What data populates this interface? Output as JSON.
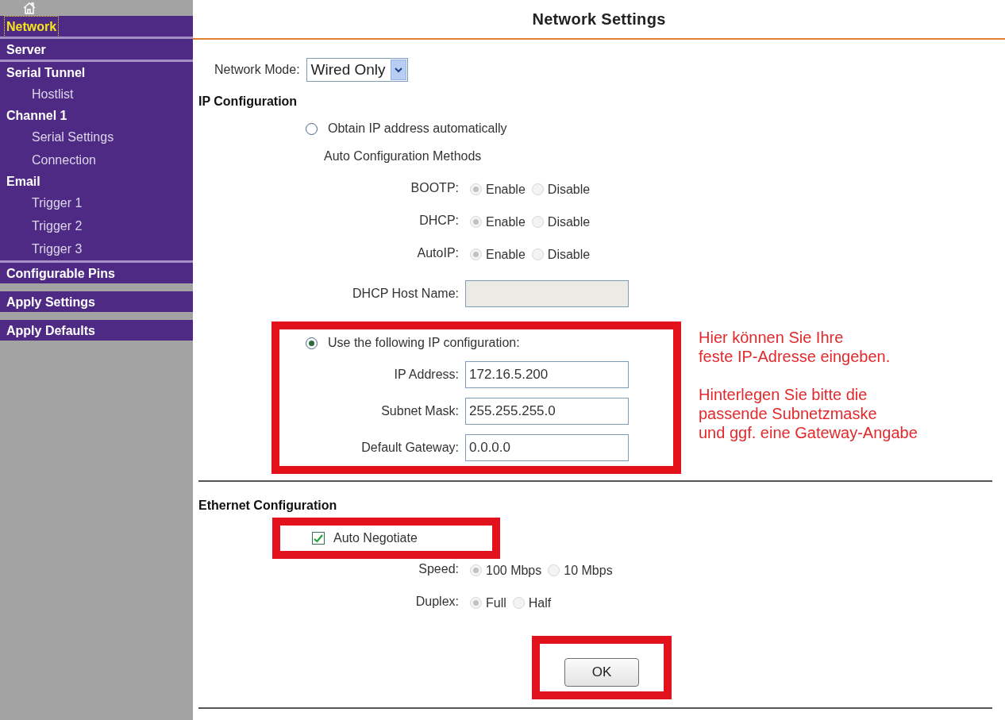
{
  "sidebar": {
    "groups": [
      {
        "divider_above": false,
        "gap_above": false,
        "items": [
          {
            "label": "Network",
            "selected": true
          }
        ]
      },
      {
        "divider_above": true,
        "gap_above": false,
        "items": [
          {
            "label": "Server",
            "selected": false
          }
        ]
      },
      {
        "divider_above": true,
        "gap_above": false,
        "items": [
          {
            "label": "Serial Tunnel",
            "selected": false,
            "children": [
              {
                "label": "Hostlist",
                "selected": false
              }
            ]
          },
          {
            "label": "Channel 1",
            "selected": false,
            "children": [
              {
                "label": "Serial Settings",
                "selected": false
              },
              {
                "label": "Connection",
                "selected": false
              }
            ]
          },
          {
            "label": "Email",
            "selected": false,
            "children": [
              {
                "label": "Trigger 1",
                "selected": false
              },
              {
                "label": "Trigger 2",
                "selected": false
              },
              {
                "label": "Trigger 3",
                "selected": false
              }
            ]
          }
        ]
      },
      {
        "divider_above": true,
        "gap_above": false,
        "items": [
          {
            "label": "Configurable Pins",
            "selected": false
          }
        ]
      },
      {
        "divider_above": false,
        "gap_above": true,
        "items": [
          {
            "label": "Apply Settings",
            "selected": false
          }
        ]
      },
      {
        "divider_above": false,
        "gap_above": true,
        "items": [
          {
            "label": "Apply Defaults",
            "selected": false
          }
        ]
      }
    ]
  },
  "title": "Network Settings",
  "network_mode": {
    "label": "Network Mode:",
    "value": "Wired Only"
  },
  "ip_configuration": {
    "heading": "IP Configuration",
    "auto": {
      "label": "Obtain IP address automatically",
      "selected": false,
      "methods_heading": "Auto Configuration Methods",
      "methods": [
        {
          "label": "BOOTP:",
          "disabled": true,
          "options": [
            {
              "label": "Enable",
              "selected": true
            },
            {
              "label": "Disable",
              "selected": false
            }
          ]
        },
        {
          "label": "DHCP:",
          "disabled": true,
          "options": [
            {
              "label": "Enable",
              "selected": true
            },
            {
              "label": "Disable",
              "selected": false
            }
          ]
        },
        {
          "label": "AutoIP:",
          "disabled": true,
          "options": [
            {
              "label": "Enable",
              "selected": true
            },
            {
              "label": "Disable",
              "selected": false
            }
          ]
        }
      ],
      "host_name": {
        "label": "DHCP Host Name:",
        "disabled": true
      }
    },
    "static": {
      "label": "Use the following IP configuration:",
      "selected": true,
      "highlighted": true,
      "fields": [
        {
          "label": "IP Address:",
          "value": "172.16.5.200"
        },
        {
          "label": "Subnet Mask:",
          "value": "255.255.255.0"
        },
        {
          "label": "Default Gateway:",
          "value": "0.0.0.0"
        }
      ]
    }
  },
  "note": {
    "paragraphs": [
      [
        "Hier können Sie Ihre",
        "feste IP-Adresse eingeben."
      ],
      [
        "Hinterlegen Sie bitte die",
        "passende Subnetzmaske",
        "und ggf. eine Gateway-Angabe"
      ]
    ]
  },
  "ethernet": {
    "heading": "Ethernet Configuration",
    "auto_negotiate": {
      "label": "Auto Negotiate",
      "checked": true,
      "highlighted": true
    },
    "settings": [
      {
        "label": "Speed:",
        "disabled": true,
        "options": [
          {
            "label": "100 Mbps",
            "selected": true
          },
          {
            "label": "10 Mbps",
            "selected": false
          }
        ]
      },
      {
        "label": "Duplex:",
        "disabled": true,
        "options": [
          {
            "label": "Full",
            "selected": true
          },
          {
            "label": "Half",
            "selected": false
          }
        ]
      }
    ]
  },
  "ok_button": {
    "label": "OK",
    "highlighted": true
  }
}
